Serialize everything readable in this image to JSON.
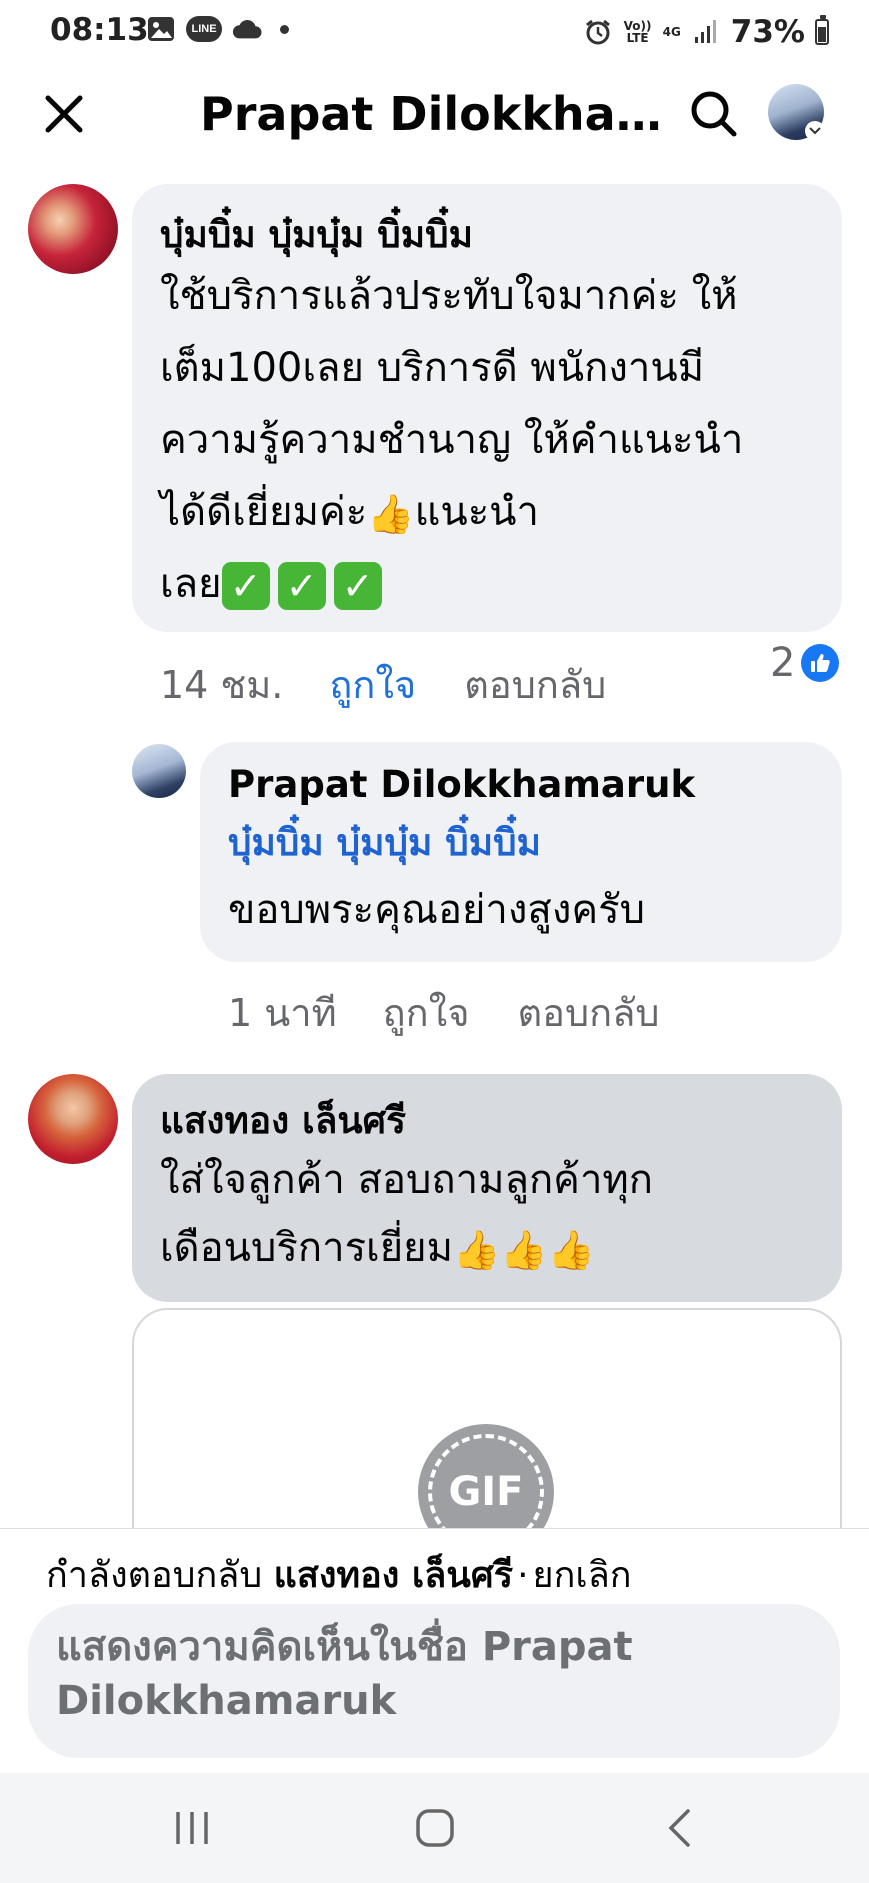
{
  "status_bar": {
    "time": "08:13",
    "left_icons": [
      "image-icon",
      "line-app-icon",
      "cloud-icon",
      "dot-icon"
    ],
    "line_label": "LINE",
    "right_icons": [
      "alarm-icon",
      "volte-icon",
      "4g-icon",
      "signal-icon",
      "battery-icon"
    ],
    "volte_label": "Vo)) LTE",
    "network_label": "4G",
    "battery": "73%"
  },
  "header": {
    "title": "Prapat Dilokkhamaruk",
    "close_icon": "close-icon",
    "search_icon": "search-icon"
  },
  "comments": [
    {
      "author": "บุ๋มบิ๋ม บุ๋มบุ๋ม บิ๋มบิ๋ม",
      "lines": [
        "ใช้บริการแล้วประทับใจมากค่ะ ให้",
        "เต็ม100เลย บริการดี พนักงานมี",
        "ความรู้ความชำนาญ ให้คำแนะนำ",
        "ได้ดีเยี่ยมค่ะ",
        "แนะนำ",
        "เลย"
      ],
      "time": "14 ชม.",
      "like_label": "ถูกใจ",
      "reply_label": "ตอบกลับ",
      "reaction_count": "2"
    },
    {
      "author": "Prapat Dilokkhamaruk",
      "mention": "บุ๋มบิ๋ม บุ๋มบุ๋ม บิ๋มบิ๋ม",
      "text": "ขอบพระคุณอย่างสูงครับ",
      "time": "1 นาที",
      "like_label": "ถูกใจ",
      "reply_label": "ตอบกลับ"
    },
    {
      "author": "แสงทอง เล็นศรี",
      "lines": [
        "ใส่ใจลูกค้า สอบถามลูกค้าทุก",
        "เดือนบริการเยี่ยม"
      ]
    }
  ],
  "gif": {
    "label": "GIF"
  },
  "composer": {
    "replying_prefix": "กำลังตอบกลับ",
    "replying_to": "แสงทอง เล็นศรี",
    "separator": "·",
    "cancel_label": "ยกเลิก",
    "placeholder": "แสดงความคิดเห็นในชื่อ Prapat Dilokkhamaruk"
  },
  "navbar": {
    "buttons": [
      "recents-icon",
      "home-icon",
      "back-icon"
    ]
  },
  "colors": {
    "accent_blue": "#1877f2",
    "mention_blue": "#1f63d0",
    "bubble_gray": "#eff1f4",
    "highlight_bubble": "#d7dade",
    "secondary_text": "#65676b"
  }
}
